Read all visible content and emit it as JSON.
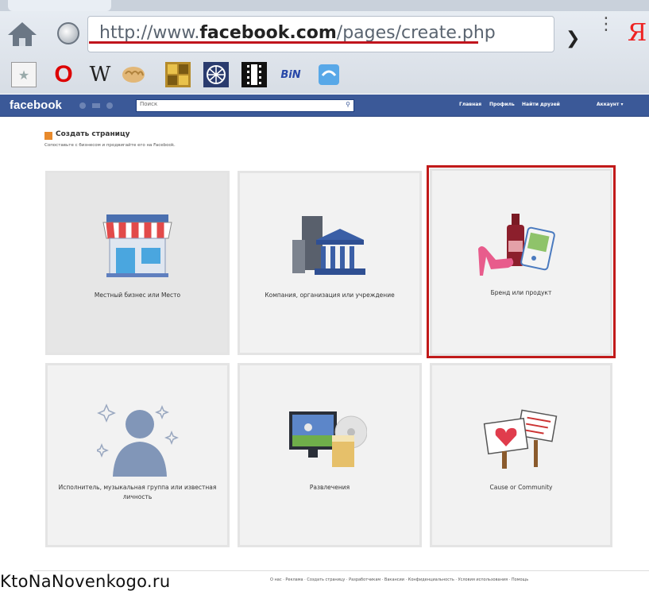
{
  "browser": {
    "url_prefix": "http://www.",
    "url_domain": "facebook.com",
    "url_path": "/pages/create.php",
    "search_engine_glyph": "Я",
    "bookmarks": [
      {
        "name": "blank-page-icon",
        "glyph": "★"
      },
      {
        "name": "opera-icon",
        "glyph": "O"
      },
      {
        "name": "wikipedia-icon",
        "glyph": "W"
      },
      {
        "name": "brain-icon",
        "glyph": ""
      },
      {
        "name": "puzzle-icon",
        "glyph": ""
      },
      {
        "name": "globe-app-icon",
        "glyph": ""
      },
      {
        "name": "film-icon",
        "glyph": ""
      },
      {
        "name": "bin-icon",
        "glyph": "BiN"
      },
      {
        "name": "drop-icon",
        "glyph": ""
      }
    ]
  },
  "facebook": {
    "logo": "facebook",
    "search_placeholder": "Поиск",
    "nav": [
      "Главная",
      "Профиль",
      "Найти друзей",
      "Аккаунт ▾"
    ]
  },
  "page": {
    "title": "Создать страницу",
    "subtitle": "Сопоставьте с бизнесом и продвигайте его на Facebook."
  },
  "tiles": [
    {
      "label": "Местный бизнес или Место",
      "icon": "storefront-icon"
    },
    {
      "label": "Компания, организация или учреждение",
      "icon": "company-building-icon"
    },
    {
      "label": "Бренд или продукт",
      "icon": "brand-product-icon"
    },
    {
      "label": "Исполнитель, музыкальная группа или известная личность",
      "icon": "artist-person-icon"
    },
    {
      "label": "Развлечения",
      "icon": "entertainment-icon"
    },
    {
      "label": "Cause or Community",
      "icon": "cause-community-icon"
    }
  ],
  "footer": {
    "watermark": "KtoNaNovenkogo.ru",
    "links": "О нас · Реклама · Создать страницу · Разработчикам · Вакансии · Конфиденциальность · Условия использования · Помощь"
  }
}
